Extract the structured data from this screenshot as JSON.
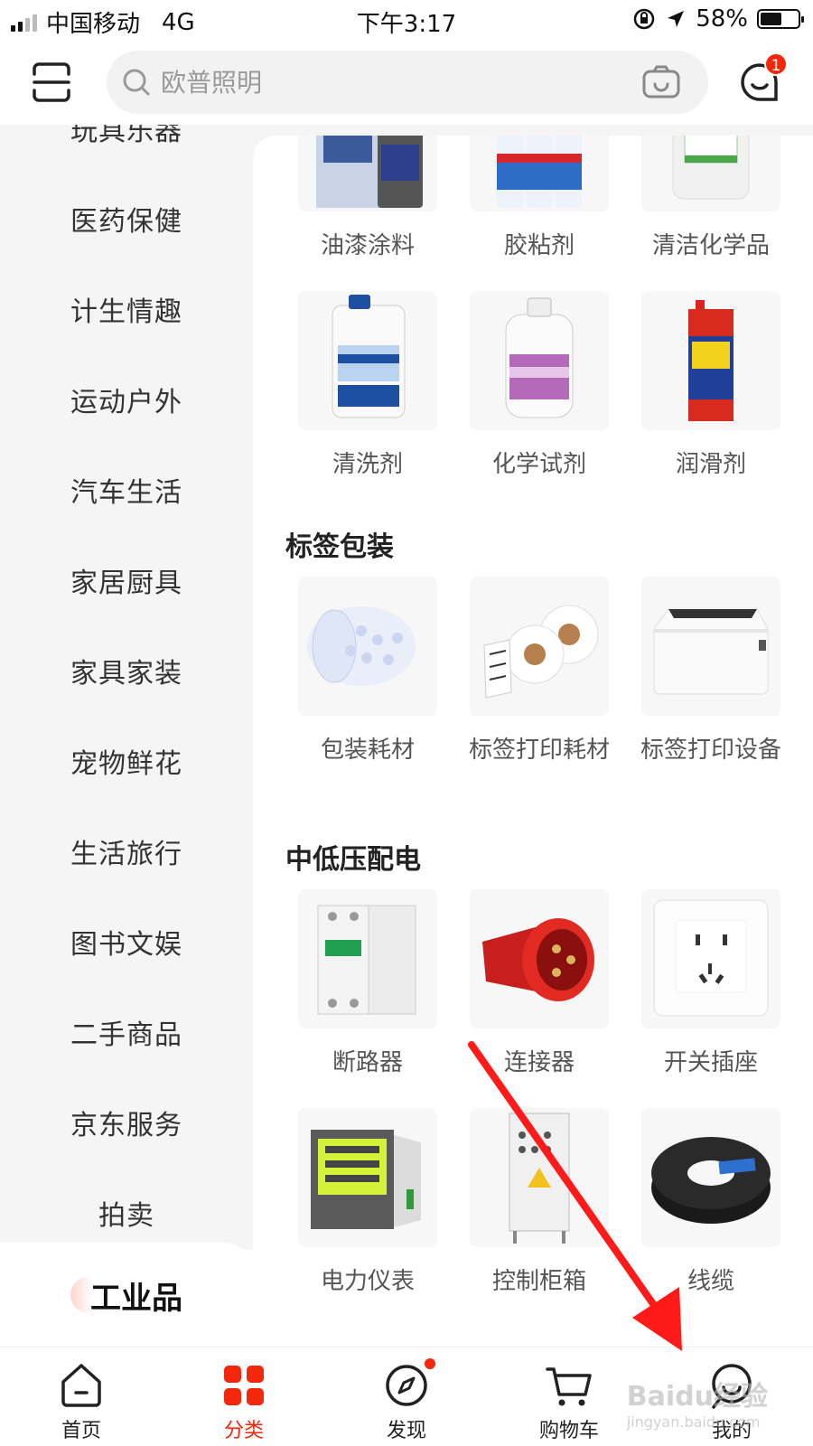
{
  "status_bar": {
    "carrier": "中国移动",
    "network": "4G",
    "time": "下午3:17",
    "battery": "58%",
    "battery_level": 0.58
  },
  "header": {
    "search_placeholder": "欧普照明",
    "message_badge": "1"
  },
  "sidebar": {
    "items": [
      "玩具乐器",
      "医药保健",
      "计生情趣",
      "运动户外",
      "汽车生活",
      "家居厨具",
      "家具家装",
      "宠物鲜花",
      "生活旅行",
      "图书文娱",
      "二手商品",
      "京东服务",
      "拍卖"
    ],
    "active": "工业品"
  },
  "content": {
    "row1": [
      "油漆涂料",
      "胶粘剂",
      "清洁化学品"
    ],
    "row2": [
      "清洗剂",
      "化学试剂",
      "润滑剂"
    ],
    "section_packaging": "标签包装",
    "row3": [
      "包装耗材",
      "标签打印耗材",
      "标签打印设备"
    ],
    "section_power": "中低压配电",
    "row4": [
      "断路器",
      "连接器",
      "开关插座"
    ],
    "row5": [
      "电力仪表",
      "控制柜箱",
      "线缆"
    ]
  },
  "tabbar": {
    "tabs": [
      "首页",
      "分类",
      "发现",
      "购物车",
      "我的"
    ],
    "active": "分类"
  },
  "colors": {
    "accent": "#f2270c",
    "annotation_arrow": "#ff1a1a"
  },
  "watermark": {
    "brand": "Baidu经验",
    "url": "jingyan.baidu.com"
  }
}
